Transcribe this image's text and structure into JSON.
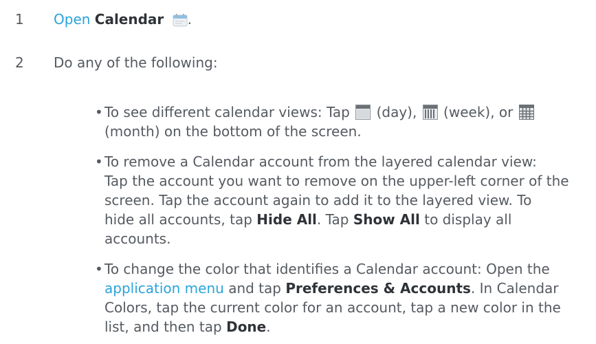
{
  "steps": [
    {
      "number": "1",
      "link_text": "Open",
      "bold_text": "Calendar",
      "icon": "calendar-icon",
      "trailing": "."
    },
    {
      "number": "2",
      "text": "Do any of the following:"
    }
  ],
  "bullets": {
    "b1": {
      "line1_a": "To see different calendar views: Tap",
      "day_label": "(day),",
      "week_label": "(week), or",
      "line2": "(month) on the bottom of the screen.",
      "icons": [
        "day-view-icon",
        "week-view-icon",
        "month-view-icon"
      ]
    },
    "b2": {
      "line1": "To remove a Calendar account from the layered calendar view:",
      "line2": "Tap the account you want to remove on the upper-left corner of the",
      "line3": "screen. Tap the account again to add it to the layered view. To",
      "line4_a": "hide all accounts, tap",
      "line4_bold1": "Hide All",
      "line4_b": ". Tap",
      "line4_bold2": "Show All",
      "line4_c": "to display all",
      "line5": "accounts."
    },
    "b3": {
      "line1": "To change the color that identifies a Calendar account: Open the",
      "line2_link": "application menu",
      "line2_a": "and tap",
      "line2_bold": "Preferences & Accounts",
      "line2_b": ". In Calendar",
      "line3": "Colors, tap the current color for an account, tap a new color in the",
      "line4_a": "list, and then tap",
      "line4_bold": "Done",
      "line4_b": "."
    }
  },
  "colors": {
    "text": "#555a60",
    "bold": "#2f3338",
    "link": "#2aa3dc"
  }
}
